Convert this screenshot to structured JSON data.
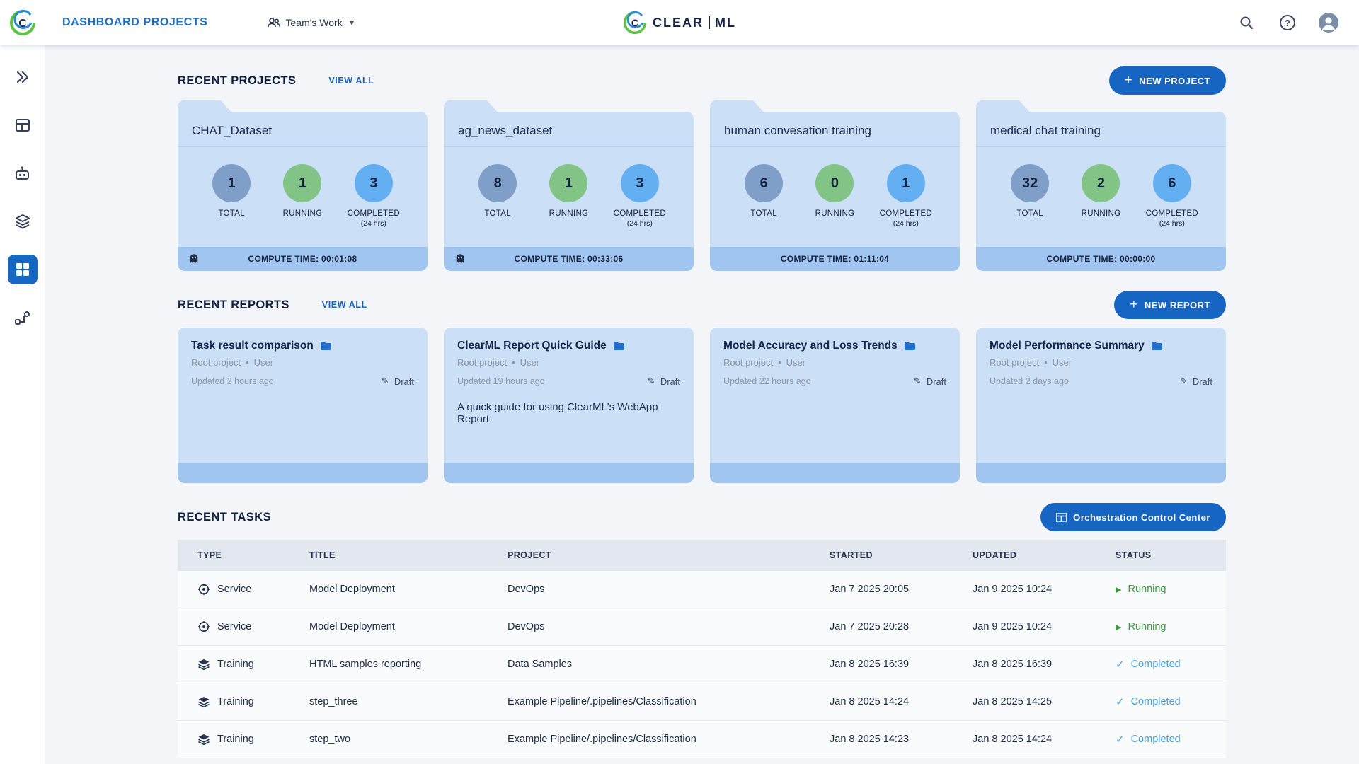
{
  "topbar": {
    "title": "DASHBOARD PROJECTS",
    "workspace_label": "Team's Work",
    "logo_left": "CLEAR",
    "logo_right": "ML"
  },
  "icons": {
    "plus": "+",
    "caret": "▾",
    "question": "?",
    "bullet": "•",
    "pencil": "✎",
    "play": "▶",
    "check": "✓"
  },
  "projects": {
    "heading": "RECENT PROJECTS",
    "view_all": "VIEW ALL",
    "new_button": "NEW PROJECT",
    "stat_labels": {
      "total": "TOTAL",
      "running": "RUNNING",
      "completed": "COMPLETED",
      "window": "(24 hrs)"
    },
    "cards": [
      {
        "name": "CHAT_Dataset",
        "total": "1",
        "running": "1",
        "completed": "3",
        "compute_time": "COMPUTE TIME: 00:01:08"
      },
      {
        "name": "ag_news_dataset",
        "total": "8",
        "running": "1",
        "completed": "3",
        "compute_time": "COMPUTE TIME: 00:33:06"
      },
      {
        "name": "human convesation training",
        "total": "6",
        "running": "0",
        "completed": "1",
        "compute_time": "COMPUTE TIME: 01:11:04"
      },
      {
        "name": "medical chat training",
        "total": "32",
        "running": "2",
        "completed": "6",
        "compute_time": "COMPUTE TIME: 00:00:00"
      }
    ]
  },
  "reports": {
    "heading": "RECENT REPORTS",
    "view_all": "VIEW ALL",
    "new_button": "NEW REPORT",
    "cards": [
      {
        "title": "Task result comparison",
        "project": "Root project",
        "author": "User",
        "updated": "Updated 2 hours ago",
        "status": "Draft",
        "description": ""
      },
      {
        "title": "ClearML Report Quick Guide",
        "project": "Root project",
        "author": "User",
        "updated": "Updated 19 hours ago",
        "status": "Draft",
        "description": "A quick guide for using ClearML's WebApp Report"
      },
      {
        "title": "Model Accuracy and Loss Trends",
        "project": "Root project",
        "author": "User",
        "updated": "Updated 22 hours ago",
        "status": "Draft",
        "description": ""
      },
      {
        "title": "Model Performance Summary",
        "project": "Root project",
        "author": "User",
        "updated": "Updated 2 days ago",
        "status": "Draft",
        "description": ""
      }
    ]
  },
  "tasks": {
    "heading": "RECENT TASKS",
    "orchestration_button": "Orchestration Control Center",
    "columns": [
      "TYPE",
      "TITLE",
      "PROJECT",
      "STARTED",
      "UPDATED",
      "STATUS"
    ],
    "rows": [
      {
        "type": "Service",
        "title": "Model Deployment",
        "project": "DevOps",
        "started": "Jan 7 2025 20:05",
        "updated": "Jan 9 2025 10:24",
        "status": "Running"
      },
      {
        "type": "Service",
        "title": "Model Deployment",
        "project": "DevOps",
        "started": "Jan 7 2025 20:28",
        "updated": "Jan 9 2025 10:24",
        "status": "Running"
      },
      {
        "type": "Training",
        "title": "HTML samples reporting",
        "project": "Data Samples",
        "started": "Jan 8 2025 16:39",
        "updated": "Jan 8 2025 16:39",
        "status": "Completed"
      },
      {
        "type": "Training",
        "title": "step_three",
        "project": "Example Pipeline/.pipelines/Classification",
        "started": "Jan 8 2025 14:24",
        "updated": "Jan 8 2025 14:25",
        "status": "Completed"
      },
      {
        "type": "Training",
        "title": "step_two",
        "project": "Example Pipeline/.pipelines/Classification",
        "started": "Jan 8 2025 14:23",
        "updated": "Jan 8 2025 14:24",
        "status": "Completed"
      }
    ]
  }
}
